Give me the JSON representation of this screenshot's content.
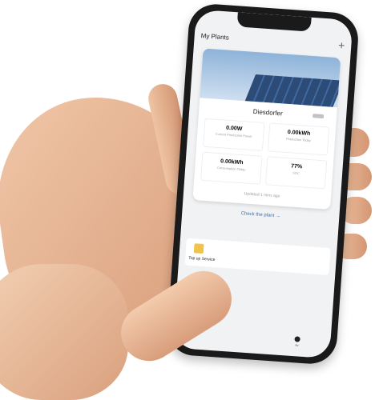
{
  "header": {
    "title": "My Plants",
    "add_label": "+"
  },
  "plant": {
    "name": "Diesdorfer",
    "metrics": [
      {
        "value": "0.00W",
        "label": "Current Production Power"
      },
      {
        "value": "0.00kWh",
        "label": "Production Today"
      },
      {
        "value": "0.00kWh",
        "label": "Consumption Today"
      },
      {
        "value": "77%",
        "label": "SOC"
      }
    ],
    "updated": "Updated 1 mins ago"
  },
  "actions": {
    "check_plant": "Check the plant →"
  },
  "services": {
    "top_up": "Top up Service"
  },
  "tabs": {
    "active": "My"
  },
  "colors": {
    "accent": "#3b6fb5",
    "topup_icon": "#f0c44a"
  }
}
